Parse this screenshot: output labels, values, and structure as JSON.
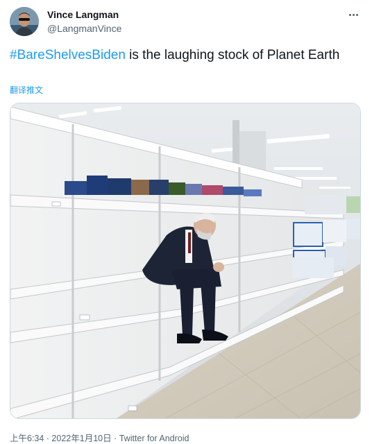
{
  "user": {
    "display_name": "Vince Langman",
    "handle": "@LangmanVince",
    "avatar_icon": "profile-photo"
  },
  "menu": {
    "icon": "more-icon"
  },
  "tweet": {
    "hashtag": "#BareShelvesBiden",
    "text": " is the laughing stock of Planet Earth",
    "translate_label": "翻译推文",
    "media_icon": "photo-empty-supermarket-shelves"
  },
  "meta": {
    "timestamp": "上午6:34 · 2022年1月10日",
    "separator": " · ",
    "source": "Twitter for Android"
  },
  "colors": {
    "link": "#1d9bf0",
    "secondary_text": "#536471"
  }
}
